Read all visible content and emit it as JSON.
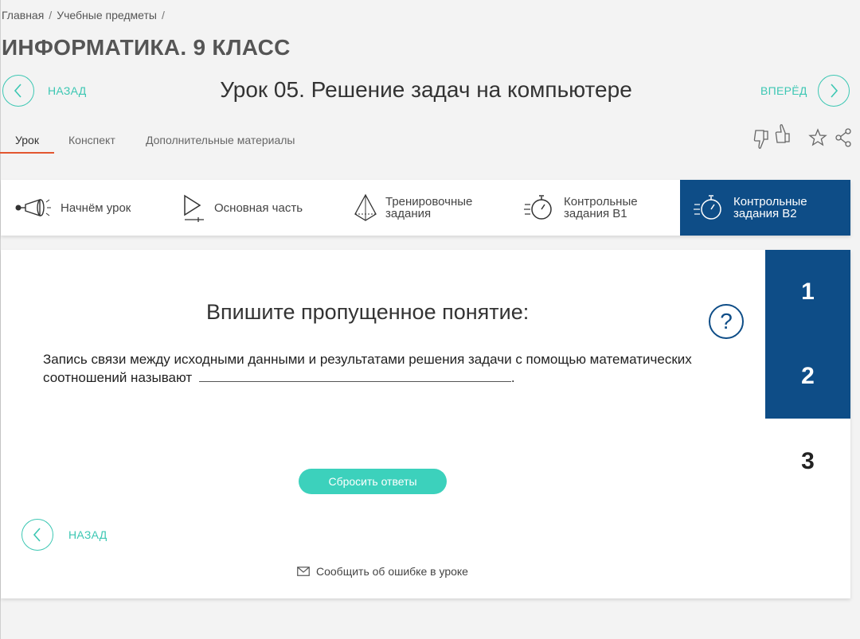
{
  "breadcrumb": {
    "items": [
      "Главная",
      "Учебные предметы"
    ],
    "separator": "/"
  },
  "subject_title": "ИНФОРМАТИКА. 9 КЛАСС",
  "nav": {
    "back_label": "НАЗАД",
    "forward_label": "ВПЕРЁД"
  },
  "lesson_title": "Урок 05. Решение задач на компьютере",
  "tabs": [
    {
      "label": "Урок",
      "active": true
    },
    {
      "label": "Конспект",
      "active": false
    },
    {
      "label": "Дополнительные материалы",
      "active": false
    }
  ],
  "actions": [
    "dislike-icon",
    "like-icon",
    "star-icon",
    "share-icon"
  ],
  "steps": [
    {
      "label": "Начнём урок",
      "icon": "megaphone-icon",
      "active": false
    },
    {
      "label": "Основная часть",
      "icon": "play-icon",
      "active": false
    },
    {
      "label": "Тренировочные задания",
      "icon": "pyramid-icon",
      "active": false
    },
    {
      "label": "Контрольные задания В1",
      "icon": "stopwatch-icon",
      "active": false
    },
    {
      "label": "Контрольные задания В2",
      "icon": "stopwatch-icon",
      "active": true
    }
  ],
  "question": {
    "title": "Впишите пропущенное понятие:",
    "help_symbol": "?",
    "text_before": "Запись связи между исходными данными и результатами решения задачи с помощью математических соотношений называют",
    "text_after": ".",
    "answer_value": ""
  },
  "reset_label": "Сбросить ответы",
  "bottom_back_label": "НАЗАД",
  "report_label": "Сообщить об ошибке в уроке",
  "task_numbers": [
    {
      "label": "1",
      "filled": true
    },
    {
      "label": "2",
      "filled": true
    },
    {
      "label": "3",
      "filled": false
    }
  ],
  "colors": {
    "accent": "#3cc7b3",
    "primary": "#0e4d87",
    "active_tab_underline": "#e2562f"
  }
}
